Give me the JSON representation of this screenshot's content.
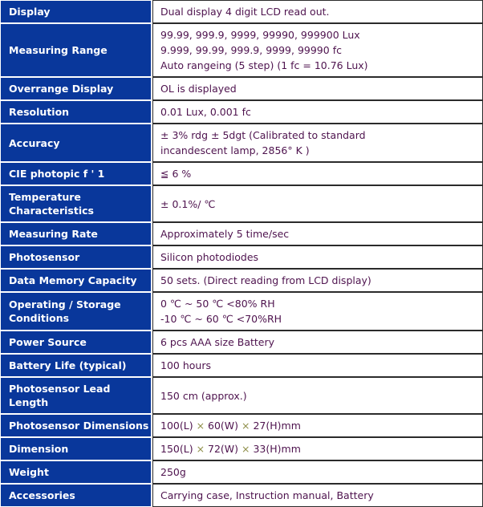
{
  "table": {
    "colors": {
      "label_background": "#09379b",
      "label_text": "#ffffff",
      "value_text": "#4e134e",
      "value_background": "#ffffff",
      "cell_border": "#2b2b2b",
      "multiply_sign": "#8f8f4a"
    },
    "rows": [
      {
        "label": "Display",
        "value": "Dual display 4 digit LCD read out.",
        "lines": 1
      },
      {
        "label": "Measuring Range",
        "value": "99.99, 999.9, 9999, 99990, 999900 Lux\n9.999, 99.99, 999.9, 9999, 99990 fc\nAuto rangeing (5 step) (1 fc = 10.76 Lux)",
        "lines": 3
      },
      {
        "label": "Overrange Display",
        "value": "OL is displayed",
        "lines": 1
      },
      {
        "label": "Resolution",
        "value": "0.01 Lux, 0.001 fc",
        "lines": 1
      },
      {
        "label": "Accuracy",
        "value": "± 3% rdg ± 5dgt (Calibrated to standard\nincandescent lamp, 2856° K )",
        "lines": 2
      },
      {
        "label": "CIE photopic f ' 1",
        "value": "≦ 6 %",
        "lines": 1
      },
      {
        "label": "Temperature Characteristics",
        "value": "± 0.1%/ ℃",
        "lines": 1
      },
      {
        "label": "Measuring Rate",
        "value": "Approximately 5 time/sec",
        "lines": 1
      },
      {
        "label": "Photosensor",
        "value": "Silicon photodiodes",
        "lines": 1
      },
      {
        "label": "Data Memory Capacity",
        "value": "50 sets. (Direct reading from LCD display)",
        "lines": 1
      },
      {
        "label": "Operating / Storage\nConditions",
        "value": "0 ℃ ~ 50 ℃ <80% RH\n-10 ℃ ~ 60 ℃ <70%RH",
        "lines": 2
      },
      {
        "label": "Power Source",
        "value": "6 pcs AAA size Battery",
        "lines": 1
      },
      {
        "label": "Battery Life (typical)",
        "value": "100 hours",
        "lines": 1
      },
      {
        "label": "Photosensor Lead Length",
        "value": "150 cm (approx.)",
        "lines": 1
      },
      {
        "label": "Photosensor Dimensions",
        "value": "100(L) × 60(W) × 27(H)mm",
        "value_parts": [
          "100(L) ",
          "×",
          " 60(W) ",
          "×",
          " 27(H)mm"
        ],
        "lines": 1
      },
      {
        "label": "Dimension",
        "value": "150(L) × 72(W) × 33(H)mm",
        "value_parts": [
          "150(L) ",
          "×",
          " 72(W) ",
          "×",
          " 33(H)mm"
        ],
        "lines": 1
      },
      {
        "label": "Weight",
        "value": "250g",
        "lines": 1
      },
      {
        "label": "Accessories",
        "value": "Carrying case, Instruction manual, Battery",
        "lines": 1
      }
    ]
  }
}
